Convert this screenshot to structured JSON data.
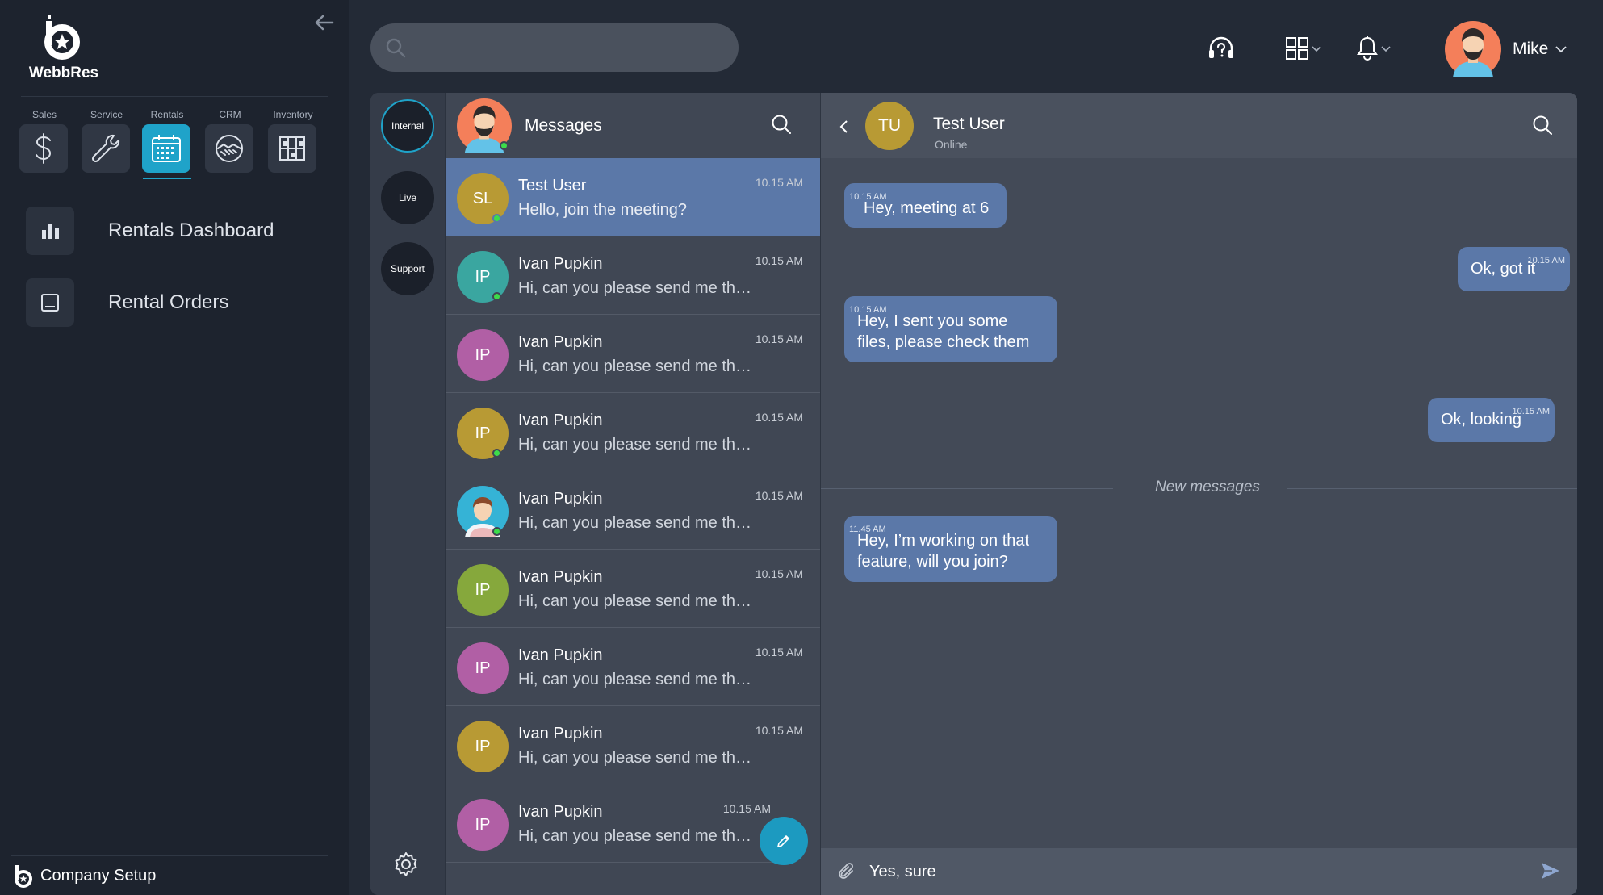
{
  "app": {
    "brand": "WebbRes",
    "collapse_icon": "arrow-left-icon",
    "accent": "#1fa3c9",
    "message_bubble": "#5b78a8",
    "online": "#3ddc4a"
  },
  "modules": [
    {
      "label": "Sales",
      "icon": "dollar-icon"
    },
    {
      "label": "Service",
      "icon": "wrench-icon"
    },
    {
      "label": "Rentals",
      "icon": "calendar-icon",
      "active": true
    },
    {
      "label": "CRM",
      "icon": "handshake-icon"
    },
    {
      "label": "Inventory",
      "icon": "warehouse-icon"
    }
  ],
  "nav": [
    {
      "label": "Rentals Dashboard",
      "icon": "bar-chart-icon"
    },
    {
      "label": "Rental Orders",
      "icon": "tablet-icon"
    }
  ],
  "footer": {
    "label": "Company Setup"
  },
  "topbar": {
    "search_value": "",
    "search_placeholder": "",
    "user_name": "Mike"
  },
  "channels": [
    {
      "label": "Internal",
      "active": true
    },
    {
      "label": "Live"
    },
    {
      "label": "Support"
    }
  ],
  "messages_panel": {
    "title": "Messages"
  },
  "conversations": [
    {
      "initials": "SL",
      "name": "Test User",
      "preview": "Hello, join the meeting?",
      "time": "10.15 AM",
      "color": "#b89a34",
      "online": true,
      "active": true
    },
    {
      "initials": "IP",
      "name": "Ivan Pupkin",
      "preview": "Hi, can you please send me those..",
      "time": "10.15 AM",
      "color": "#3aa6a0",
      "online": true
    },
    {
      "initials": "IP",
      "name": "Ivan Pupkin",
      "preview": "Hi, can you please send me those..",
      "time": "10.15 AM",
      "color": "#b15fa5",
      "online": false
    },
    {
      "initials": "IP",
      "name": "Ivan Pupkin",
      "preview": "Hi, can you please send me those..",
      "time": "10.15 AM",
      "color": "#b89a34",
      "online": true
    },
    {
      "initials": "",
      "name": "Ivan Pupkin",
      "preview": "Hi, can you please send me those..",
      "time": "10.15 AM",
      "color": "#35b3d6",
      "online": true,
      "photo": true
    },
    {
      "initials": "IP",
      "name": "Ivan Pupkin",
      "preview": "Hi, can you please send me those..",
      "time": "10.15 AM",
      "color": "#86a83c",
      "online": false
    },
    {
      "initials": "IP",
      "name": "Ivan Pupkin",
      "preview": "Hi, can you please send me those..",
      "time": "10.15 AM",
      "color": "#b15fa5",
      "online": false
    },
    {
      "initials": "IP",
      "name": "Ivan Pupkin",
      "preview": "Hi, can you please send me those..",
      "time": "10.15 AM",
      "color": "#b89a34",
      "online": false
    },
    {
      "initials": "IP",
      "name": "Ivan Pupkin",
      "preview": "Hi, can you please send me those...",
      "time": "10.15 AM",
      "color": "#b15fa5",
      "online": false
    }
  ],
  "thread": {
    "initials": "TU",
    "name": "Test User",
    "status": "Online",
    "avatar_color": "#b89a34",
    "messages": [
      {
        "dir": "in",
        "time": "10.15 AM",
        "lines": [
          "Hey, meeting at 6"
        ]
      },
      {
        "dir": "out",
        "time": "10.15 AM",
        "lines": [
          "Ok, got it"
        ]
      },
      {
        "dir": "in",
        "time": "10.15 AM",
        "lines": [
          "Hey, I sent you some",
          "files, please check them"
        ]
      },
      {
        "dir": "out",
        "time": "10.15 AM",
        "lines": [
          "Ok, looking"
        ]
      },
      {
        "dir": "in",
        "time": "11.45 AM",
        "lines": [
          "Hey, I’m working on that",
          "feature, will you join?"
        ]
      }
    ],
    "divider_label": "New messages",
    "composer_value": "Yes, sure"
  }
}
